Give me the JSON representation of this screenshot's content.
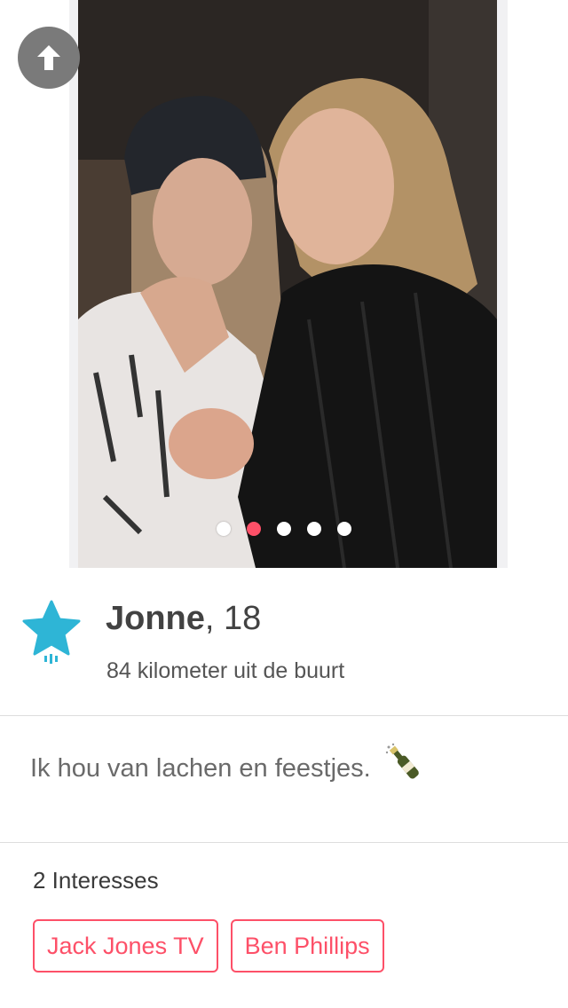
{
  "header": {
    "back_icon": "arrow-up-icon"
  },
  "photo": {
    "alt": "Profile photo of two girls smiling",
    "dot_count": 5,
    "active_dot_index": 1
  },
  "profile": {
    "name": "Jonne",
    "age": ", 18",
    "distance": "84 kilometer uit de buurt",
    "badge_icon": "star-badge-icon",
    "badge_color": "#2eb5d6"
  },
  "bio": {
    "text": "Ik hou van lachen en feestjes.",
    "emoji_icon": "champagne-bottle-icon"
  },
  "interests": {
    "heading": "2 Interesses",
    "items": [
      "Jack Jones TV",
      "Ben Phillips"
    ]
  },
  "colors": {
    "accent": "#fd5068",
    "text_dark": "#424242",
    "text_muted": "#6a6a6a",
    "divider": "#dddddd"
  }
}
